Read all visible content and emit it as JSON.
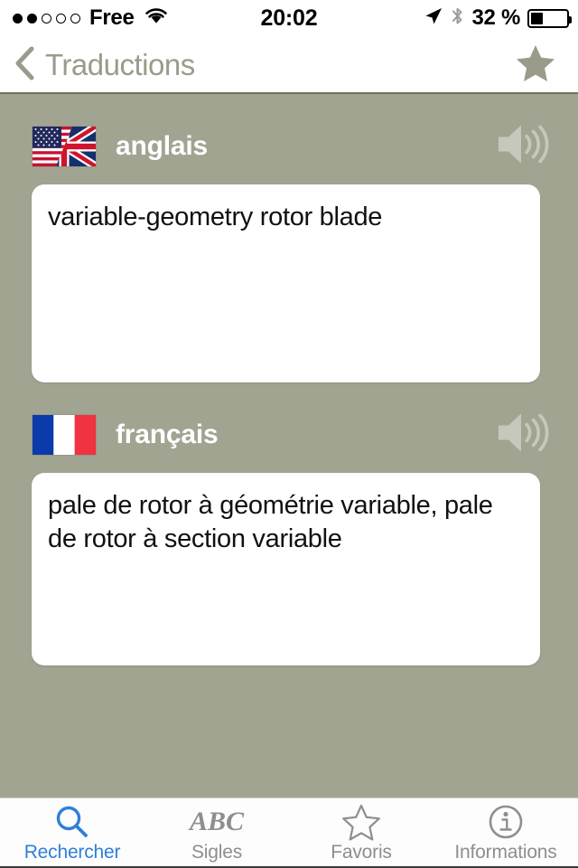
{
  "status_bar": {
    "signal_dots_total": 5,
    "signal_dots_filled": 2,
    "carrier": "Free",
    "wifi_icon": "wifi-icon",
    "time": "20:02",
    "location_icon": "location-arrow-icon",
    "bluetooth_icon": "bluetooth-icon",
    "battery_percent_label": "32 %",
    "battery_level": 32
  },
  "nav_bar": {
    "back_icon": "chevron-left-icon",
    "back_title": "Traductions",
    "favorite_icon": "star-filled-icon"
  },
  "colors": {
    "background": "#a2a492",
    "nav_text": "#9a9b8a",
    "card": "#ffffff",
    "accent": "#2f7fd8",
    "tab_inactive": "#8e8e8e",
    "flag_fr_blue": "#0b3bab",
    "flag_fr_red": "#ef3340",
    "us_blue": "#21295c",
    "us_red": "#c8102e",
    "uk_blue": "#14306b",
    "uk_red": "#cf142b"
  },
  "entries": [
    {
      "flag_icon": "flag-us-uk-icon",
      "language": "anglais",
      "speaker_icon": "speaker-wave-icon",
      "text": "variable-geometry rotor blade"
    },
    {
      "flag_icon": "flag-france-icon",
      "language": "français",
      "speaker_icon": "speaker-wave-icon",
      "text": "pale de rotor à géométrie variable, pale de rotor à section variable"
    }
  ],
  "tab_bar": {
    "tabs": [
      {
        "icon": "search-icon",
        "label": "Rechercher",
        "active": true
      },
      {
        "icon": "abc-icon",
        "label": "Sigles",
        "active": false
      },
      {
        "icon": "star-outline-icon",
        "label": "Favoris",
        "active": false
      },
      {
        "icon": "info-circle-icon",
        "label": "Informations",
        "active": false
      }
    ]
  }
}
